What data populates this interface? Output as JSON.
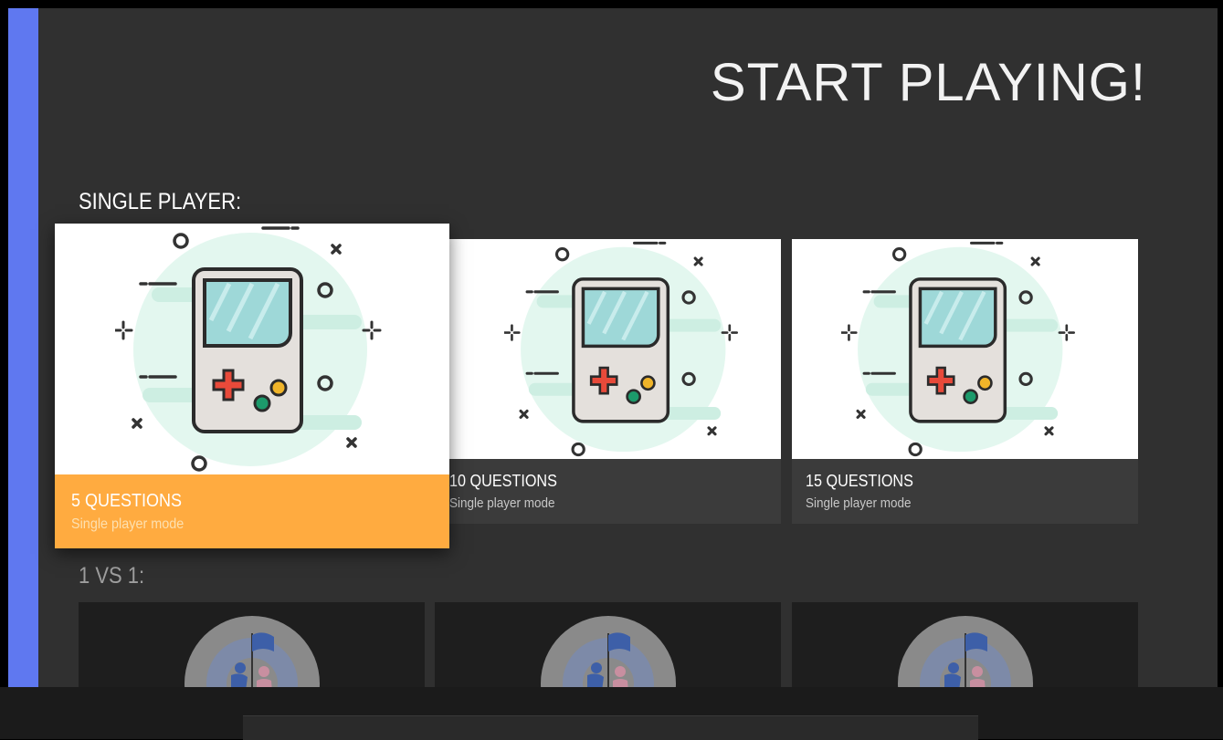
{
  "header": {
    "title": "START PLAYING!"
  },
  "sections": {
    "single": {
      "label": "SINGLE PLAYER:"
    },
    "versus": {
      "label": "1 VS 1:"
    }
  },
  "single_cards": [
    {
      "title": "5 QUESTIONS",
      "subtitle": "Single player mode",
      "icon": "gameboy-icon",
      "focused": true
    },
    {
      "title": "10 QUESTIONS",
      "subtitle": "Single player mode",
      "icon": "gameboy-icon",
      "focused": false
    },
    {
      "title": "15 QUESTIONS",
      "subtitle": "Single player mode",
      "icon": "gameboy-icon",
      "focused": false
    }
  ],
  "versus_cards": [
    {
      "icon": "versus-flag-icon"
    },
    {
      "icon": "versus-flag-icon"
    },
    {
      "icon": "versus-flag-icon"
    }
  ],
  "colors": {
    "background": "#303030",
    "accent_rail": "#5f78f0",
    "focus": "#ffab40",
    "card": "#3b3b3b"
  }
}
